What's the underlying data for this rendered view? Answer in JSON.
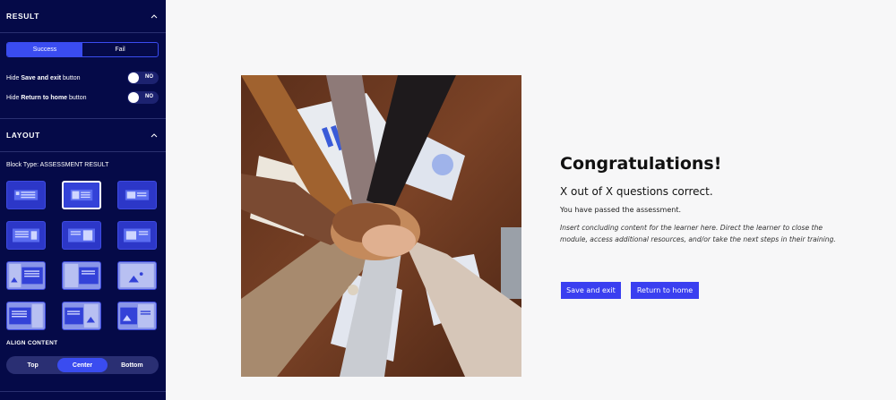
{
  "sidebar": {
    "result_section": {
      "title": "RESULT",
      "icon": "chevron-up-icon"
    },
    "result_tabs": [
      {
        "label": "Success",
        "active": true
      },
      {
        "label": "Fail",
        "active": false
      }
    ],
    "hide_save": {
      "prefix": "Hide ",
      "bold": "Save and exit",
      "suffix": " button",
      "toggle_text": "NO"
    },
    "hide_return": {
      "prefix": "Hide ",
      "bold": "Return to home",
      "suffix": " button",
      "toggle_text": "NO"
    },
    "layout_section": {
      "title": "LAYOUT",
      "icon": "chevron-up-icon"
    },
    "block_type": "Block Type: ASSESSMENT RESULT",
    "align_content": {
      "label": "ALIGN CONTENT",
      "options": [
        {
          "label": "Top",
          "active": false
        },
        {
          "label": "Center",
          "active": true
        },
        {
          "label": "Bottom",
          "active": false
        }
      ]
    }
  },
  "content": {
    "title": "Congratulations!",
    "score": "X out of X questions correct.",
    "passed": "You have passed the assessment.",
    "concluding": "Insert concluding content for the learner here. Direct the learner to close the module, access additional resources, and/or take the next steps in their training.",
    "save_button": "Save and exit",
    "return_button": "Return to home"
  },
  "colors": {
    "sidebar_bg": "#050a48",
    "accent": "#3a4cf0",
    "button": "#3a3ff0"
  }
}
